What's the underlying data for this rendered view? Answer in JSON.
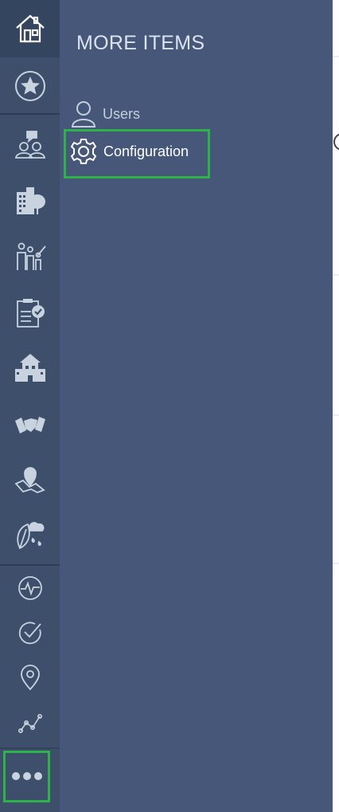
{
  "panel": {
    "title": "MORE ITEMS",
    "items": [
      {
        "label": "Users",
        "icon": "user-icon"
      },
      {
        "label": "Configuration",
        "icon": "gear-icon"
      }
    ]
  },
  "rail": {
    "items": [
      {
        "icon": "home-icon"
      },
      {
        "icon": "star-icon"
      },
      {
        "icon": "people-chat-icon"
      },
      {
        "icon": "city-buildings-icon"
      },
      {
        "icon": "family-icon"
      },
      {
        "icon": "checklist-icon"
      },
      {
        "icon": "school-building-icon"
      },
      {
        "icon": "handshake-icon"
      },
      {
        "icon": "map-pin-icon"
      },
      {
        "icon": "weather-leaf-icon"
      },
      {
        "icon": "activity-icon"
      },
      {
        "icon": "check-circle-icon"
      },
      {
        "icon": "location-icon"
      },
      {
        "icon": "graph-icon"
      },
      {
        "icon": "more-icon"
      }
    ]
  },
  "colors": {
    "rail_bg": "#3d4f6b",
    "panel_bg": "#46577a",
    "highlight": "#2db34a"
  }
}
